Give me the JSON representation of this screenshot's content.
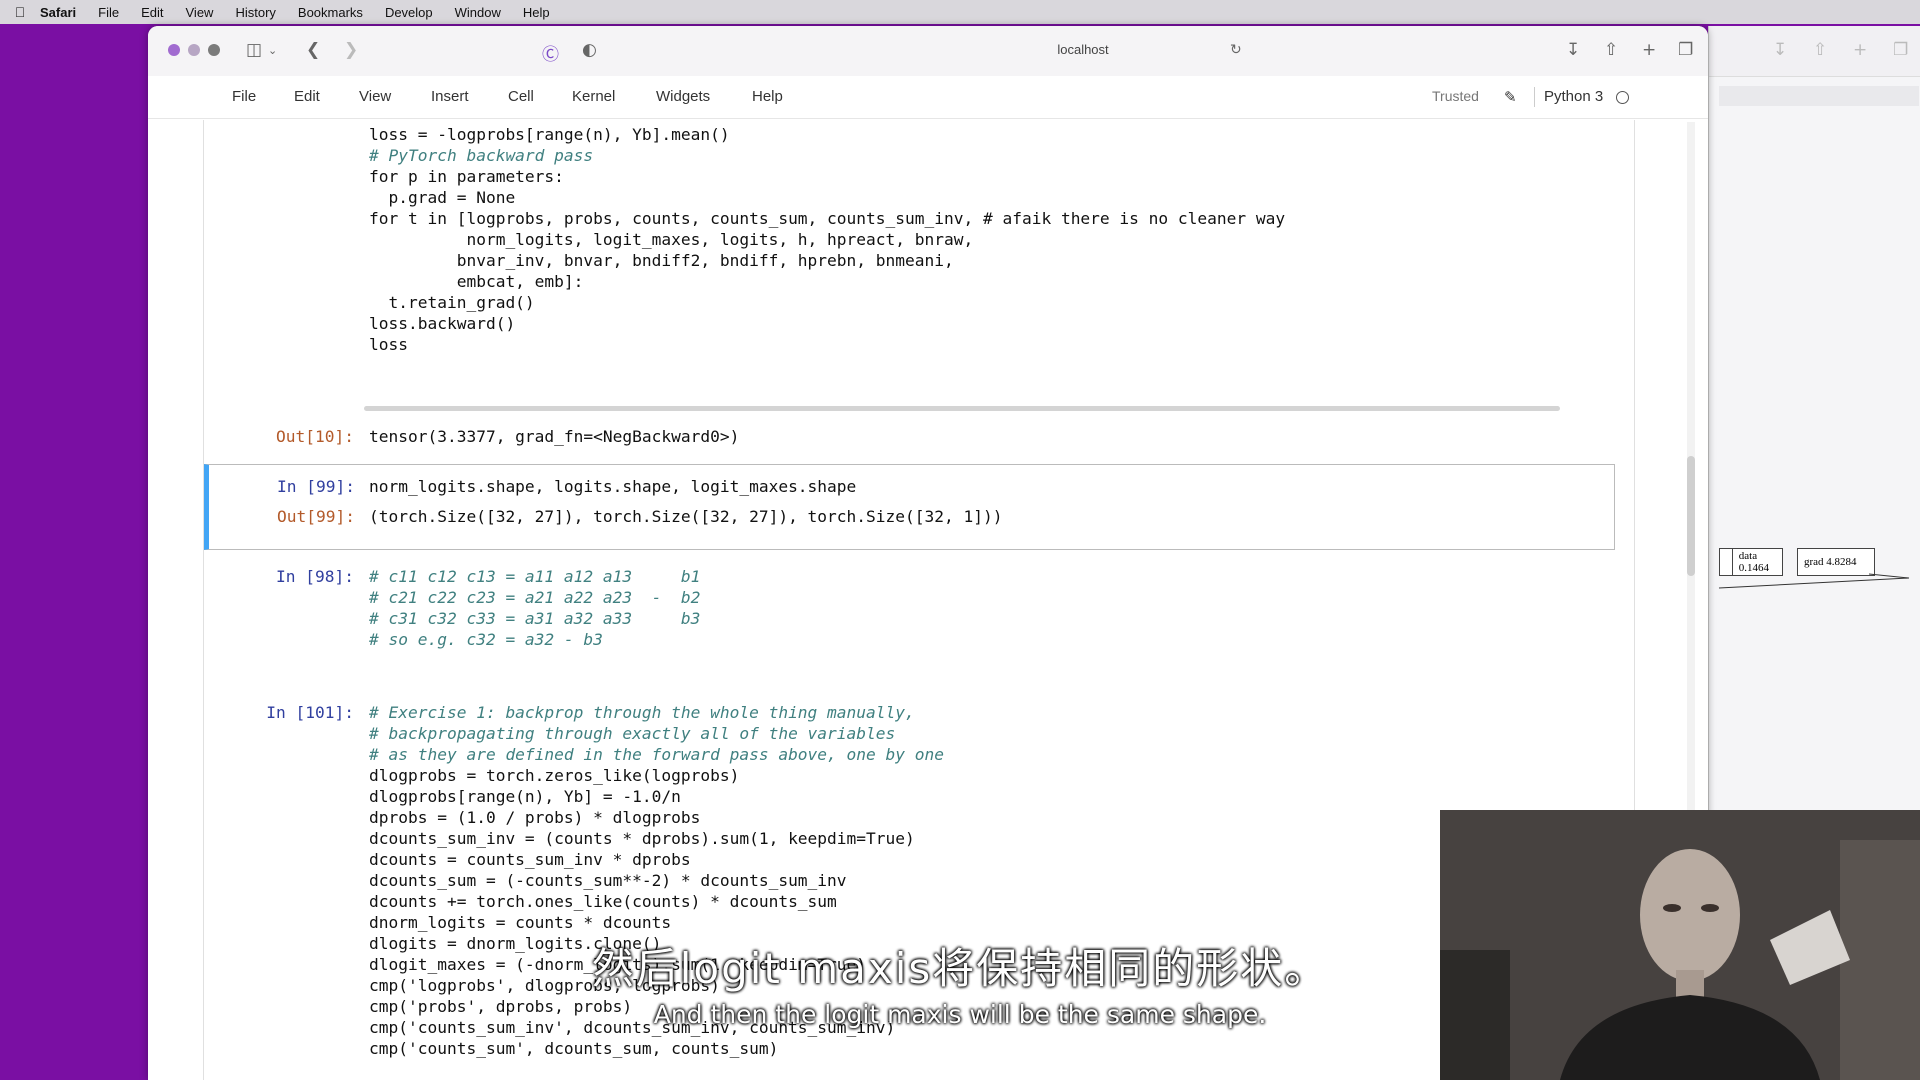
{
  "menubar": {
    "app": "Safari",
    "items": [
      "File",
      "Edit",
      "View",
      "History",
      "Bookmarks",
      "Develop",
      "Window",
      "Help"
    ]
  },
  "browser": {
    "address": "localhost"
  },
  "jupyter": {
    "menu": [
      "File",
      "Edit",
      "View",
      "Insert",
      "Cell",
      "Kernel",
      "Widgets",
      "Help"
    ],
    "trusted": "Trusted",
    "kernel": "Python 3"
  },
  "cells": {
    "c10": {
      "code": [
        "loss = -logprobs[range(n), Yb].mean()",
        "",
        "# PyTorch backward pass",
        "for p in parameters:",
        "  p.grad = None",
        "for t in [logprobs, probs, counts, counts_sum, counts_sum_inv, # afaik there is no cleaner way",
        "          norm_logits, logit_maxes, logits, h, hpreact, bnraw,",
        "         bnvar_inv, bnvar, bndiff2, bndiff, hprebn, bnmeani,",
        "         embcat, emb]:",
        "  t.retain_grad()",
        "loss.backward()",
        "loss"
      ],
      "out_prompt": "Out[10]:",
      "out": "tensor(3.3377, grad_fn=<NegBackward0>)"
    },
    "c99": {
      "in_prompt": "In [99]:",
      "code": "norm_logits.shape, logits.shape, logit_maxes.shape",
      "out_prompt": "Out[99]:",
      "out": "(torch.Size([32, 27]), torch.Size([32, 27]), torch.Size([32, 1]))"
    },
    "c98": {
      "in_prompt": "In [98]:",
      "code": [
        "# c11 c12 c13 = a11 a12 a13     b1",
        "# c21 c22 c23 = a21 a22 a23  -  b2",
        "# c31 c32 c33 = a31 a32 a33     b3",
        "",
        "# so e.g. c32 = a32 - b3"
      ]
    },
    "c101": {
      "in_prompt": "In [101]:",
      "code": [
        "# Exercise 1: backprop through the whole thing manually,",
        "# backpropagating through exactly all of the variables",
        "# as they are defined in the forward pass above, one by one",
        "",
        "dlogprobs = torch.zeros_like(logprobs)",
        "dlogprobs[range(n), Yb] = -1.0/n",
        "dprobs = (1.0 / probs) * dlogprobs",
        "dcounts_sum_inv = (counts * dprobs).sum(1, keepdim=True)",
        "dcounts = counts_sum_inv * dprobs",
        "dcounts_sum = (-counts_sum**-2) * dcounts_sum_inv",
        "dcounts += torch.ones_like(counts) * dcounts_sum",
        "dnorm_logits = counts * dcounts",
        "dlogits = dnorm_logits.clone()",
        "dlogit_maxes = (-dnorm_logits).sum(1, keepdim=True)",
        "",
        "cmp('logprobs', dlogprobs, logprobs)",
        "cmp('probs', dprobs, probs)",
        "cmp('counts_sum_inv', dcounts_sum_inv, counts_sum_inv)",
        "cmp('counts_sum', dcounts_sum, counts_sum)"
      ]
    }
  },
  "side_panel": {
    "node_data": "data 0.1464",
    "node_grad": "grad 4.8284"
  },
  "subtitles": {
    "zh": "然后logit maxis将保持相同的形状。",
    "en": "And then the logit maxis will be the same shape."
  }
}
